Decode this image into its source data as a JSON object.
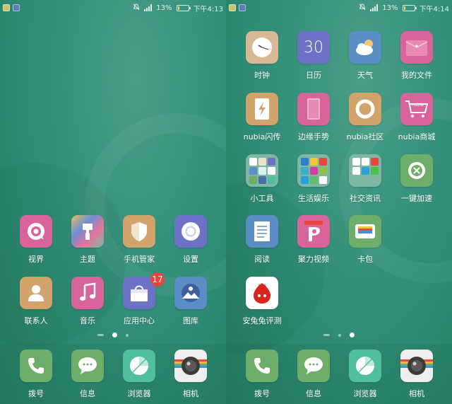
{
  "status_left": {
    "battery_pct": "13%",
    "time": "下午4:13",
    "battery_level": 0.13
  },
  "status_right": {
    "battery_pct": "13%",
    "time": "下午4:14",
    "battery_level": 0.13
  },
  "left_screen": {
    "apps": [
      {
        "label": "视界",
        "icon": "video-eye-icon",
        "color": "#d8649c"
      },
      {
        "label": "主题",
        "icon": "theme-brush-icon",
        "color": "#e4c25a"
      },
      {
        "label": "手机管家",
        "icon": "shield-icon",
        "color": "#d2a46b"
      },
      {
        "label": "设置",
        "icon": "settings-gear-icon",
        "color": "#6d72c6"
      },
      {
        "label": "联系人",
        "icon": "person-icon",
        "color": "#d2a46b"
      },
      {
        "label": "音乐",
        "icon": "music-note-icon",
        "color": "#d8649c"
      },
      {
        "label": "应用中心",
        "icon": "shopping-bag-icon",
        "color": "#6d72c6",
        "badge": "17"
      },
      {
        "label": "图库",
        "icon": "gallery-icon",
        "color": "#5c8ec6"
      }
    ],
    "dock": [
      {
        "label": "拨号",
        "icon": "phone-icon",
        "color": "#6fae6a"
      },
      {
        "label": "信息",
        "icon": "message-bubble-icon",
        "color": "#6fae6a"
      },
      {
        "label": "浏览器",
        "icon": "browser-compass-icon",
        "color": "#4fbf9e"
      },
      {
        "label": "相机",
        "icon": "camera-lens-icon",
        "color": "#eeeeee"
      }
    ]
  },
  "right_screen": {
    "apps": [
      {
        "label": "时钟",
        "icon": "clock-icon",
        "color": "#d9b896"
      },
      {
        "label": "日历",
        "icon": "calendar-icon",
        "color": "#6d72c6",
        "day": "30"
      },
      {
        "label": "天气",
        "icon": "weather-cloud-icon",
        "color": "#5c8ec6"
      },
      {
        "label": "我的文件",
        "icon": "folder-icon",
        "color": "#d8649c"
      },
      {
        "label": "nubia闪传",
        "icon": "flash-transfer-icon",
        "color": "#d2a46b"
      },
      {
        "label": "边缘手势",
        "icon": "edge-gesture-icon",
        "color": "#d8649c"
      },
      {
        "label": "nubia社区",
        "icon": "community-ring-icon",
        "color": "#d2a46b"
      },
      {
        "label": "nubia商城",
        "icon": "shopping-cart-icon",
        "color": "#d8649c",
        "brand": "nubia"
      },
      {
        "label": "小工具",
        "icon": "tools-folder-icon",
        "color": "#7fb7a4"
      },
      {
        "label": "生活娱乐",
        "icon": "life-folder-icon",
        "color": "#7fb7a4"
      },
      {
        "label": "社交资讯",
        "icon": "social-folder-icon",
        "color": "#7fb7a4"
      },
      {
        "label": "一键加速",
        "icon": "boost-icon",
        "color": "#6fae6a"
      },
      {
        "label": "阅读",
        "icon": "book-icon",
        "color": "#5c8ec6"
      },
      {
        "label": "聚力视频",
        "icon": "pptv-video-icon",
        "color": "#d8649c"
      },
      {
        "label": "卡包",
        "icon": "wallet-icon",
        "color": "#6fae6a"
      },
      {
        "label": "安兔兔评测",
        "icon": "antutu-icon",
        "color": "#ffffff"
      }
    ],
    "dock": [
      {
        "label": "拨号",
        "icon": "phone-icon",
        "color": "#6fae6a"
      },
      {
        "label": "信息",
        "icon": "message-bubble-icon",
        "color": "#6fae6a"
      },
      {
        "label": "浏览器",
        "icon": "browser-compass-icon",
        "color": "#4fbf9e"
      },
      {
        "label": "相机",
        "icon": "camera-lens-icon",
        "color": "#eeeeee"
      }
    ]
  }
}
